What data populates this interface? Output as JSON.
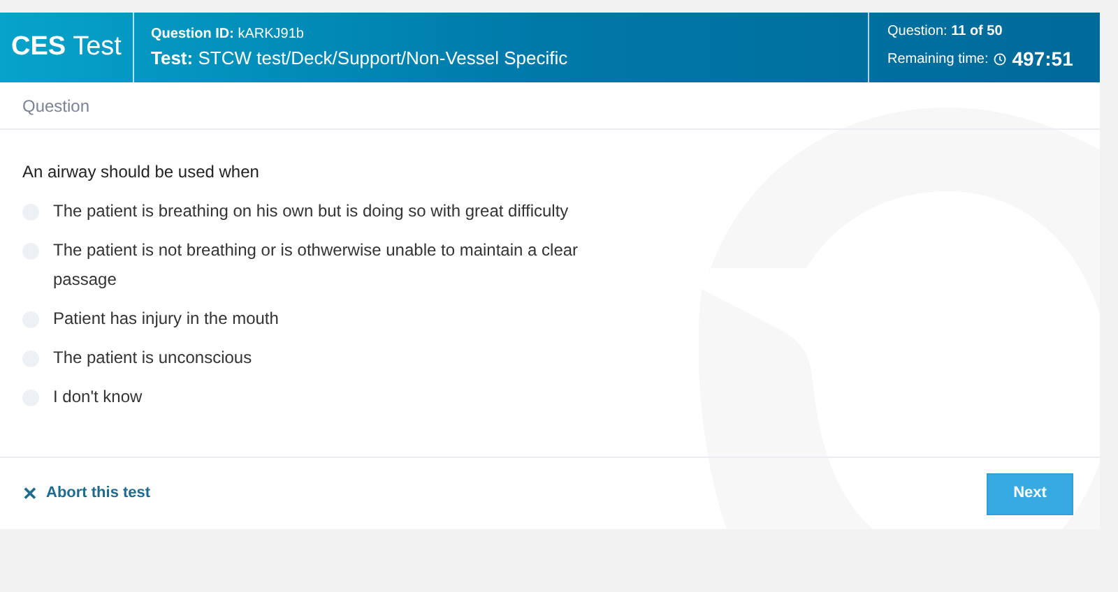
{
  "header": {
    "logo_bold": "CES",
    "logo_light": "Test",
    "question_id_label": "Question ID:",
    "question_id": "kARKJ91b",
    "test_label": "Test:",
    "test_name": "STCW test/Deck/Support/Non-Vessel Specific",
    "progress_label": "Question:",
    "progress": "11 of 50",
    "time_label": "Remaining time:",
    "time": "497:51"
  },
  "section_title": "Question",
  "question": "An airway should be used when",
  "answers": [
    {
      "text": "The patient is breathing on his own but is doing so with great difficulty",
      "selected": false
    },
    {
      "text": "The patient is not breathing or is othwerwise unable to maintain a clear passage",
      "selected": false
    },
    {
      "text": "Patient has injury in the mouth",
      "selected": false
    },
    {
      "text": "The patient is unconscious",
      "selected": false
    },
    {
      "text": "I don't know",
      "selected": false
    }
  ],
  "abort": {
    "icon": "✕",
    "label": "Abort this test"
  },
  "next_button": "Next"
}
